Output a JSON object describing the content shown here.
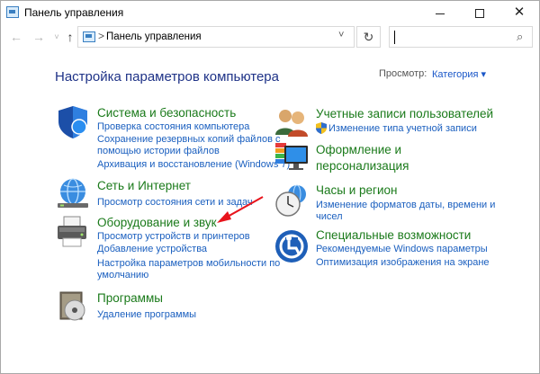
{
  "window": {
    "title": "Панель управления",
    "minimize_glyph": "",
    "close_glyph": "✕"
  },
  "nav": {
    "back_glyph": "←",
    "forward_glyph": "→",
    "recent_glyph": "˅",
    "up_glyph": "↑",
    "address_sep": ">",
    "address": "Панель управления",
    "address_dd": "˅",
    "refresh_glyph": "↻",
    "search_value": "",
    "search_glyph": "⌕"
  },
  "header": {
    "title": "Настройка параметров компьютера",
    "view_label": "Просмотр:",
    "view_value": "Категория ▾"
  },
  "categories": {
    "system": {
      "title": "Система и безопасность",
      "icon": "shield-icon",
      "links": [
        "Проверка состояния компьютера",
        "Сохранение резервных копий файлов с",
        "помощью истории файлов",
        "Архивация и восстановление (Windows 7)"
      ]
    },
    "network": {
      "title": "Сеть и Интернет",
      "icon": "globe-network-icon",
      "links": [
        "Просмотр состояния сети и задач"
      ]
    },
    "hardware": {
      "title": "Оборудование и звук",
      "icon": "printer-icon",
      "links": [
        "Просмотр устройств и принтеров",
        "Добавление устройства",
        "Настройка параметров мобильности по",
        "умолчанию"
      ]
    },
    "programs": {
      "title": "Программы",
      "icon": "programs-disc-icon",
      "links": [
        "Удаление программы"
      ]
    },
    "users": {
      "title": "Учетные записи пользователей",
      "icon": "users-icon",
      "links": [
        "Изменение типа учетной записи"
      ]
    },
    "appearance": {
      "title_line1": "Оформление и",
      "title_line2": "персонализация",
      "icon": "monitor-palette-icon",
      "links": []
    },
    "clock": {
      "title": "Часы и регион",
      "icon": "clock-globe-icon",
      "links": [
        "Изменение форматов даты, времени и",
        "чисел"
      ]
    },
    "access": {
      "title": "Специальные возможности",
      "icon": "accessibility-icon",
      "links": [
        "Рекомендуемые Windows параметры",
        "Оптимизация изображения на экране"
      ]
    }
  },
  "colors": {
    "category_title": "#1a7a1a",
    "link": "#1a5fbf",
    "heading": "#1e3287",
    "annotation_arrow": "#e8141c"
  }
}
